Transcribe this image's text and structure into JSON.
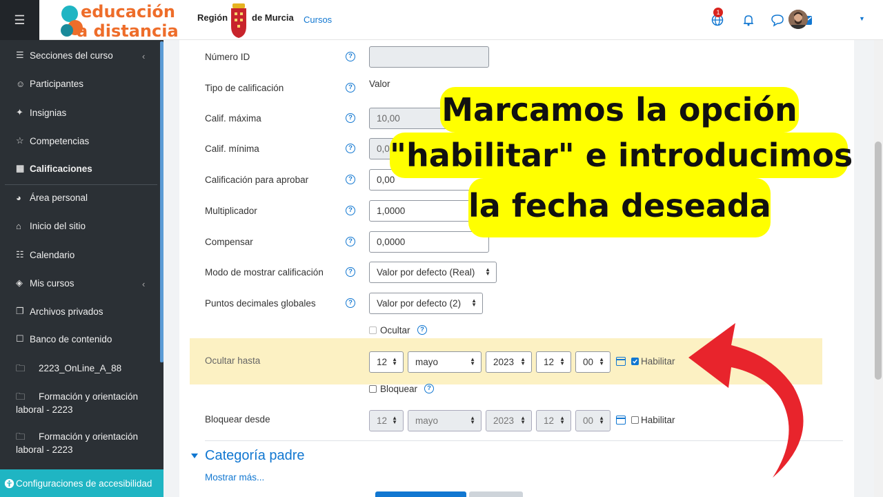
{
  "sidebar": {
    "items": [
      {
        "label": "Secciones del curso",
        "icon": "list-icon",
        "arrow": "‹"
      },
      {
        "label": "Participantes",
        "icon": "users-icon"
      },
      {
        "label": "Insignias",
        "icon": "badge-icon"
      },
      {
        "label": "Competencias",
        "icon": "star-icon"
      },
      {
        "label": "Calificaciones",
        "icon": "table-icon"
      },
      {
        "label": "Área personal",
        "icon": "dashboard-icon"
      },
      {
        "label": "Inicio del sitio",
        "icon": "home-icon"
      },
      {
        "label": "Calendario",
        "icon": "calendar-icon"
      },
      {
        "label": "Mis cursos",
        "icon": "graduation-cap-icon",
        "arrow": "‹"
      },
      {
        "label": "Archivos privados",
        "icon": "files-icon"
      },
      {
        "label": "Banco de contenido",
        "icon": "paste-icon"
      }
    ],
    "courses": [
      {
        "label": "2223_OnLine_A_88"
      },
      {
        "label": "Formación y orientación laboral - 2223"
      },
      {
        "label": "Formación y orientación laboral - 2223"
      }
    ],
    "accessibility": "Configuraciones de accesibilidad"
  },
  "topbar": {
    "logo_line1": "educación",
    "logo_line2": "a distancia",
    "region_left": "Región",
    "region_right": "de Murcia",
    "cursos_link": "Cursos",
    "notification_count": "1"
  },
  "form": {
    "numero_id": {
      "label": "Número ID",
      "value": ""
    },
    "tipo": {
      "label": "Tipo de calificación",
      "value": "Valor"
    },
    "calif_max": {
      "label": "Calif. máxima",
      "value": "10,00"
    },
    "calif_min": {
      "label": "Calif. mínima",
      "value": "0,00"
    },
    "aprobar": {
      "label": "Calificación para aprobar",
      "value": "0,00"
    },
    "multiplicador": {
      "label": "Multiplicador",
      "value": "1,0000"
    },
    "compensar": {
      "label": "Compensar",
      "value": "0,0000"
    },
    "modo": {
      "label": "Modo de mostrar calificación",
      "value": "Valor por defecto (Real)"
    },
    "decimales": {
      "label": "Puntos decimales globales",
      "value": "Valor por defecto (2)"
    },
    "ocultar": {
      "label": "Ocultar",
      "checked": false
    },
    "ocultar_hasta": {
      "label": "Ocultar hasta",
      "day": "12",
      "month": "mayo",
      "year": "2023",
      "hour": "12",
      "minute": "00",
      "enable_label": "Habilitar",
      "enabled": true
    },
    "bloquear": {
      "label": "Bloquear",
      "checked": false
    },
    "bloquear_desde": {
      "label": "Bloquear desde",
      "day": "12",
      "month": "mayo",
      "year": "2023",
      "hour": "12",
      "minute": "00",
      "enable_label": "Habilitar",
      "enabled": false
    }
  },
  "section": {
    "title": "Categoría padre",
    "more": "Mostrar más..."
  },
  "callout": {
    "line1": "Marcamos la opción",
    "line2": "\"habilitar\" e introducimos",
    "line3": "la fecha deseada"
  },
  "colors": {
    "sidebar": "#2b3035",
    "accent": "#1177d1",
    "highlight": "#fcf1c3",
    "callout": "#ffff00",
    "arrow": "#e8242c",
    "accessibility": "#1fb5c3"
  }
}
